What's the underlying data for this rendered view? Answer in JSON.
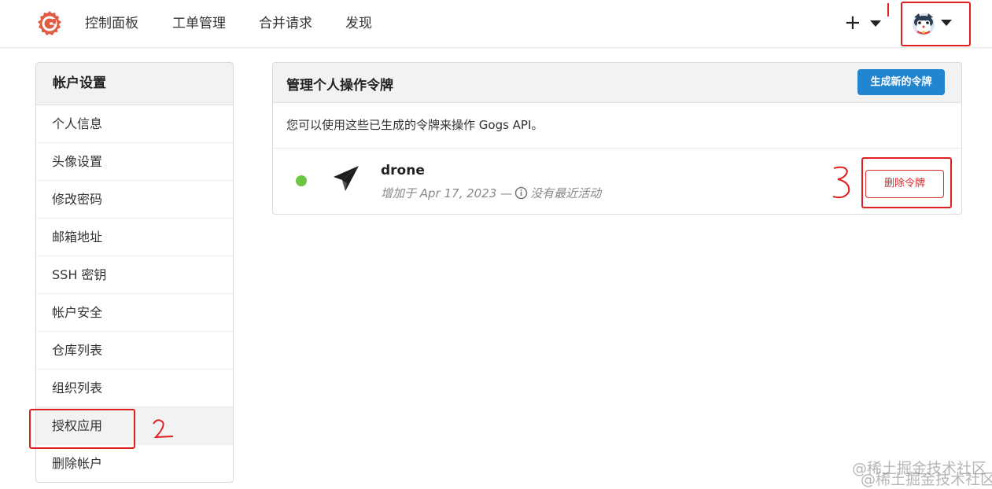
{
  "nav": {
    "items": [
      "控制面板",
      "工单管理",
      "合并请求",
      "发现"
    ],
    "plus_label": "+"
  },
  "sidebar": {
    "title": "帐户设置",
    "items": [
      {
        "label": "个人信息",
        "active": false
      },
      {
        "label": "头像设置",
        "active": false
      },
      {
        "label": "修改密码",
        "active": false
      },
      {
        "label": "邮箱地址",
        "active": false
      },
      {
        "label": "SSH 密钥",
        "active": false
      },
      {
        "label": "帐户安全",
        "active": false
      },
      {
        "label": "仓库列表",
        "active": false
      },
      {
        "label": "组织列表",
        "active": false
      },
      {
        "label": "授权应用",
        "active": true
      },
      {
        "label": "删除帐户",
        "active": false
      }
    ]
  },
  "panel": {
    "title": "管理个人操作令牌",
    "generate_button": "生成新的令牌",
    "description": "您可以使用这些已生成的令牌来操作 Gogs API。",
    "token": {
      "name": "drone",
      "added_text": "增加于 Apr 17, 2023 —",
      "activity_text": "没有最近活动",
      "delete_button": "删除令牌",
      "status_color": "#6cc644"
    }
  },
  "annotations": {
    "labels": [
      "1",
      "2",
      "3"
    ],
    "color": "#e02020"
  },
  "watermark": "@稀土掘金技术社区",
  "colors": {
    "primary": "#2185d0",
    "danger": "#db2828",
    "logo": "#e05d44"
  }
}
